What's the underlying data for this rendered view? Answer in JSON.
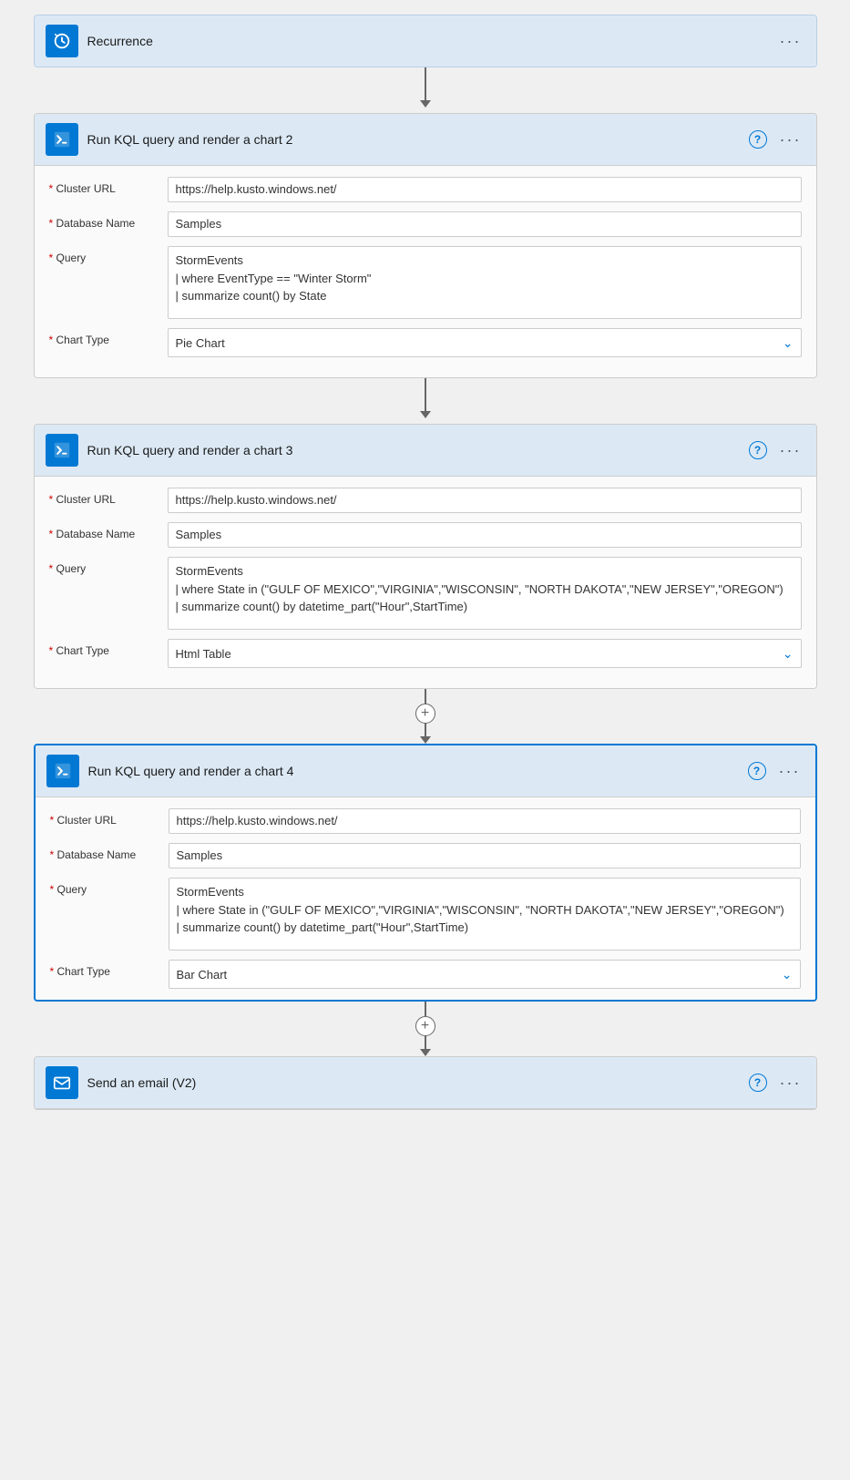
{
  "recurrence": {
    "title": "Recurrence",
    "menu_label": "···"
  },
  "step2": {
    "title": "Run KQL query and render a chart 2",
    "help_tooltip": "?",
    "menu_label": "···",
    "fields": {
      "cluster_url_label": "* Cluster URL",
      "cluster_url_value": "https://help.kusto.windows.net/",
      "database_name_label": "* Database Name",
      "database_name_value": "Samples",
      "query_label": "* Query",
      "query_value": "StormEvents\n| where EventType == \"Winter Storm\"\n| summarize count() by State",
      "chart_type_label": "* Chart Type",
      "chart_type_value": "Pie Chart"
    }
  },
  "step3": {
    "title": "Run KQL query and render a chart 3",
    "help_tooltip": "?",
    "menu_label": "···",
    "fields": {
      "cluster_url_label": "* Cluster URL",
      "cluster_url_value": "https://help.kusto.windows.net/",
      "database_name_label": "* Database Name",
      "database_name_value": "Samples",
      "query_label": "* Query",
      "query_value": "StormEvents\n| where State in (\"GULF OF MEXICO\",\"VIRGINIA\",\"WISCONSIN\", \"NORTH DAKOTA\",\"NEW JERSEY\",\"OREGON\")\n| summarize count() by datetime_part(\"Hour\",StartTime)",
      "chart_type_label": "* Chart Type",
      "chart_type_value": "Html Table"
    }
  },
  "step4": {
    "title": "Run KQL query and render a chart 4",
    "help_tooltip": "?",
    "menu_label": "···",
    "fields": {
      "cluster_url_label": "* Cluster URL",
      "cluster_url_value": "https://help.kusto.windows.net/",
      "database_name_label": "* Database Name",
      "database_name_value": "Samples",
      "query_label": "* Query",
      "query_value": "StormEvents\n| where State in (\"GULF OF MEXICO\",\"VIRGINIA\",\"WISCONSIN\", \"NORTH DAKOTA\",\"NEW JERSEY\",\"OREGON\")\n| summarize count() by datetime_part(\"Hour\",StartTime)",
      "chart_type_label": "* Chart Type",
      "chart_type_value": "Bar Chart"
    }
  },
  "email": {
    "title": "Send an email (V2)",
    "help_tooltip": "?",
    "menu_label": "···"
  },
  "plus_button": "+",
  "required_marker": "*"
}
